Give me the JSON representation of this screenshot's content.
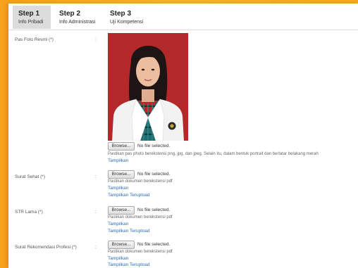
{
  "steps": [
    {
      "num": "Step 1",
      "label": "Info Pribadi",
      "active": true
    },
    {
      "num": "Step 2",
      "label": "Info Administrasi",
      "active": false
    },
    {
      "num": "Step 3",
      "label": "Uji Kompetensi",
      "active": false
    }
  ],
  "colon": ":",
  "file_input": {
    "browse_label": "Browse...",
    "no_file": "No file selected."
  },
  "fields": {
    "foto": {
      "label": "Pas Foto Resmi (*)",
      "hint": "Pastikan pas photo berekstensi png, jpg, dan jpeg. Selain itu, dalam bentuk portrait dan berlatar belakang merah",
      "show": "Tampilkan"
    },
    "surat_sehat": {
      "label": "Surat Sehat (*)",
      "hint": "Pastikan dokumen berekstensi pdf",
      "show": "Tampilkan",
      "show_uploaded": "Tampilkan Terupload"
    },
    "str_lama": {
      "label": "STR Lama (*)",
      "hint": "Pastikan dokumen berekstensi pdf",
      "show": "Tampilkan",
      "show_uploaded": "Tampilkan Terupload"
    },
    "rekomendasi": {
      "label": "Surat Rekomendasi Profesi (*)",
      "hint": "Pastikan dokumen berekstensi pdf",
      "show": "Tampilkan",
      "show_uploaded": "Tampilkan Terupload"
    }
  },
  "colors": {
    "page_background": "#f4a820",
    "photo_background": "#b3292a",
    "link": "#2a6fb8",
    "active_tab": "#dcdcdc"
  }
}
